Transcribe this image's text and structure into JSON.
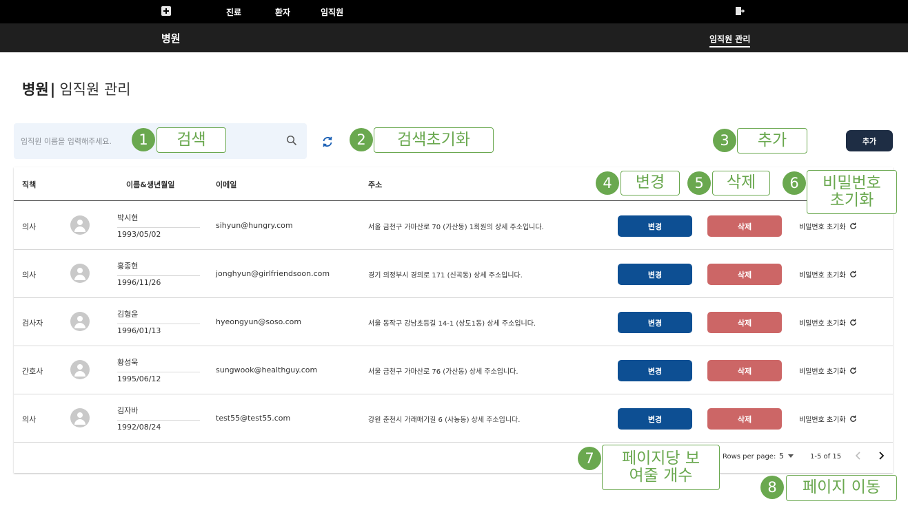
{
  "topnav": {
    "items": [
      "진료",
      "환자",
      "임직원"
    ]
  },
  "subnav": {
    "brand": "병원",
    "menu_active": "임직원 관리"
  },
  "page_title": {
    "strong": "병원",
    "separator": "|",
    "light": "임직원 관리"
  },
  "search": {
    "placeholder": "임직원 이름을 입력해주세요.",
    "value": ""
  },
  "add_button_label": "추가",
  "annotations": [
    {
      "num": "1",
      "label": "검색"
    },
    {
      "num": "2",
      "label": "검색초기화"
    },
    {
      "num": "3",
      "label": "추가"
    },
    {
      "num": "4",
      "label": "변경"
    },
    {
      "num": "5",
      "label": "삭제"
    },
    {
      "num": "6",
      "label": "비밀번호\n초기화"
    },
    {
      "num": "7",
      "label": "페이지당 보\n여줄 개수"
    },
    {
      "num": "8",
      "label": "페이지 이동"
    }
  ],
  "table": {
    "headers": {
      "position": "직책",
      "name_birth": "이름&생년월일",
      "email": "이메일",
      "address": "주소"
    },
    "rows": [
      {
        "position": "의사",
        "name": "박시현",
        "birth": "1993/05/02",
        "email": "sihyun@hungry.com",
        "address": "서울 금천구 가마산로 70 (가산동) 1회원의 상세 주소입니다.",
        "edit": "변경",
        "delete": "삭제",
        "reset": "비밀번호 초기화"
      },
      {
        "position": "의사",
        "name": "홍종현",
        "birth": "1996/11/26",
        "email": "jonghyun@girlfriendsoon.com",
        "address": "경기 의정부시 경의로 171 (신곡동) 상세 주소입니다.",
        "edit": "변경",
        "delete": "삭제",
        "reset": "비밀번호 초기화"
      },
      {
        "position": "검사자",
        "name": "김형윤",
        "birth": "1996/01/13",
        "email": "hyeongyun@soso.com",
        "address": "서울 동작구 강남초등길 14-1 (상도1동) 상세 주소입니다.",
        "edit": "변경",
        "delete": "삭제",
        "reset": "비밀번호 초기화"
      },
      {
        "position": "간호사",
        "name": "황성욱",
        "birth": "1995/06/12",
        "email": "sungwook@healthguy.com",
        "address": "서울 금천구 가마산로 76 (가산동) 상세 주소입니다.",
        "edit": "변경",
        "delete": "삭제",
        "reset": "비밀번호 초기화"
      },
      {
        "position": "의사",
        "name": "김자바",
        "birth": "1992/08/24",
        "email": "test55@test55.com",
        "address": "강원 춘천시 가래매기길 6 (사농동) 상세 주소입니다.",
        "edit": "변경",
        "delete": "삭제",
        "reset": "비밀번호 초기화"
      }
    ]
  },
  "pagination": {
    "rows_per_page_label": "Rows per page:",
    "rows_per_page_value": "5",
    "range": "1-5 of 15"
  },
  "colors": {
    "nav_bg": "#000000",
    "subnav_bg": "#1f1f1f",
    "edit_button": "#0d4f93",
    "delete_button": "#cc6666",
    "add_button": "#1e2d44",
    "annotation": "#6aa84f"
  }
}
